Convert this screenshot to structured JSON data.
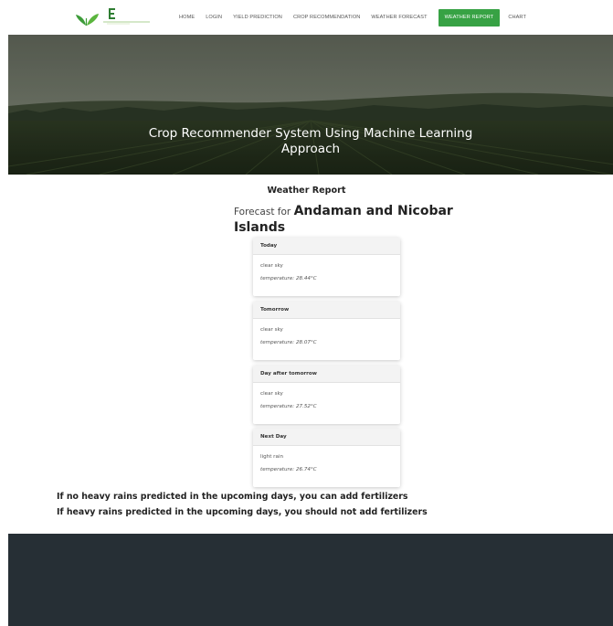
{
  "nav": {
    "items": [
      {
        "label": "HOME",
        "active": false
      },
      {
        "label": "LOGIN",
        "active": false
      },
      {
        "label": "YIELD PREDICTION",
        "active": false
      },
      {
        "label": "CROP RECOMMENDATION",
        "active": false
      },
      {
        "label": "WEATHER FORECAST",
        "active": false
      },
      {
        "label": "WEATHER REPORT",
        "active": true
      },
      {
        "label": "CHART",
        "active": false
      }
    ],
    "accent_color": "#37a244",
    "logo_icon": "leaf-logo-icon"
  },
  "hero": {
    "title_line1": "Crop Recommender System Using Machine Learning",
    "title_line2": "Approach"
  },
  "report": {
    "heading": "Weather Report",
    "forecast_prefix": "Forecast for",
    "location": "Andaman and Nicobar Islands",
    "days": [
      {
        "label": "Today",
        "description": "clear sky",
        "temperature": "temperature: 28.44°C"
      },
      {
        "label": "Tomorrow",
        "description": "clear sky",
        "temperature": "temperature: 28.07°C"
      },
      {
        "label": "Day after tomorrow",
        "description": "clear sky",
        "temperature": "temperature: 27.52°C"
      },
      {
        "label": "Next Day",
        "description": "light rain",
        "temperature": "temperature: 26.74°C"
      }
    ]
  },
  "advice": {
    "line1": "If no heavy rains predicted in the upcoming days, you can add fertilizers",
    "line2": "If heavy rains predicted in the upcoming days, you should not add fertilizers"
  },
  "colors": {
    "footer": "#262f35",
    "card_header": "#f3f3f3"
  }
}
